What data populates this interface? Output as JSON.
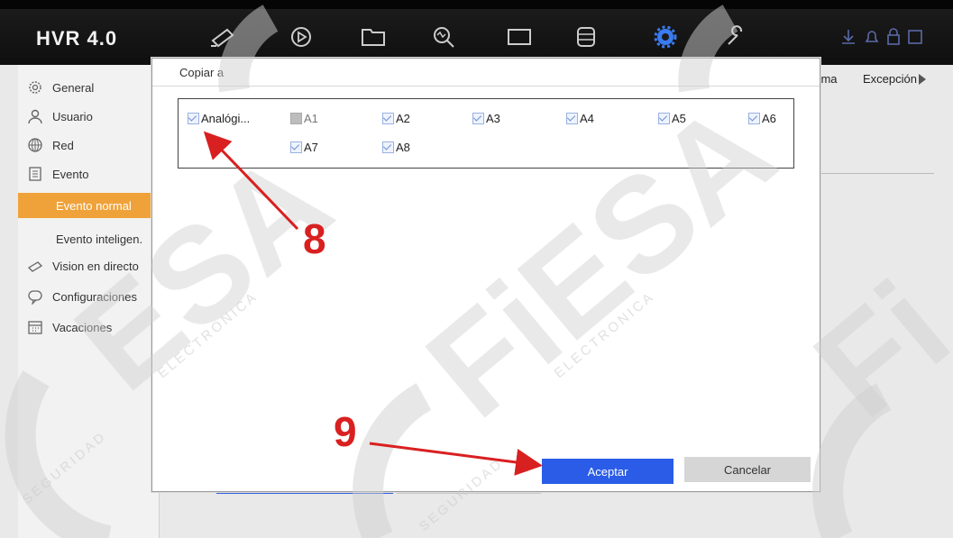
{
  "app": {
    "brand": "HVR 4.0"
  },
  "nav_icons": [
    "camera-icon",
    "playback-icon",
    "folder-icon",
    "search-icon",
    "monitor-icon",
    "storage-icon",
    "settings-gear-icon",
    "wrench-icon"
  ],
  "status_icons": [
    "download-icon",
    "alarm-icon",
    "lock-icon",
    "account-icon"
  ],
  "sidebar": {
    "items": [
      {
        "label": "General",
        "icon": "gear-icon"
      },
      {
        "label": "Usuario",
        "icon": "user-icon"
      },
      {
        "label": "Red",
        "icon": "globe-icon"
      },
      {
        "label": "Evento",
        "icon": "document-icon"
      },
      {
        "label": "Evento normal",
        "icon": ""
      },
      {
        "label": "Evento inteligen.",
        "icon": ""
      },
      {
        "label": "Vision en directo",
        "icon": "camera-icon"
      },
      {
        "label": "Configuraciones",
        "icon": "chat-icon"
      },
      {
        "label": "Vacaciones",
        "icon": "calendar-icon"
      }
    ]
  },
  "tabs": {
    "alarm": "larma",
    "exception": "Excepción"
  },
  "dialog": {
    "title": "Copiar a",
    "group_label": "Analógi...",
    "channels": [
      "A1",
      "A2",
      "A3",
      "A4",
      "A5",
      "A6",
      "A7",
      "A8"
    ],
    "ok_label": "Aceptar",
    "cancel_label": "Cancelar"
  },
  "annotations": {
    "step_a": "8",
    "step_b": "9"
  },
  "watermark": {
    "brand": "CFiESA",
    "tagline": "SEGURIDAD ELECTRONICA"
  },
  "colors": {
    "accent_orange": "#f0a23a",
    "primary_blue": "#2a5ce8",
    "annotation_red": "#d92020"
  }
}
